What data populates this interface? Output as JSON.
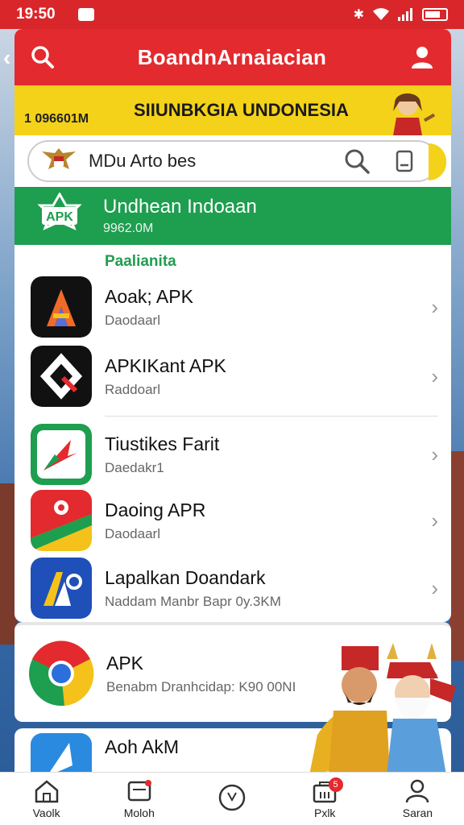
{
  "status_bar": {
    "time": "19:50"
  },
  "app_bar": {
    "title": "BoandnArnaiacian"
  },
  "banner": {
    "left_text": "1 096601M",
    "title": "SIIUNBKGIA UNDONESIA"
  },
  "search": {
    "text": "MDu Arto bes"
  },
  "featured": {
    "title": "Undhean Indoaan",
    "subtitle": "9962.0M"
  },
  "section": {
    "label": "Paalianita"
  },
  "list": [
    {
      "name": "Aoak; APK",
      "sub": "Daodaarl"
    },
    {
      "name": "APKIKant APK",
      "sub": "Raddoarl"
    },
    {
      "name": "Tiustikes Farit",
      "sub": "Daedakr1"
    },
    {
      "name": "Daoing APR",
      "sub": "Daodaarl"
    },
    {
      "name": "Lapalkan Doandark",
      "sub": "Naddam Manbr Bapr 0y.3KM"
    }
  ],
  "card2": {
    "name": "APK",
    "sub": "Benabm Dranhcidap: K90 00NI"
  },
  "card3": {
    "name": "Aoh AkM"
  },
  "nav": [
    {
      "label": "Vaolk",
      "icon": "home-icon"
    },
    {
      "label": "Moloh",
      "icon": "inbox-icon"
    },
    {
      "label": "",
      "icon": "clock-icon"
    },
    {
      "label": "Pxlk",
      "icon": "store-icon",
      "badge": "5"
    },
    {
      "label": "Saran",
      "icon": "profile-icon"
    }
  ],
  "colors": {
    "primary_red": "#e32a2e",
    "banner_yellow": "#f4d21a",
    "green": "#1e9e4f"
  }
}
